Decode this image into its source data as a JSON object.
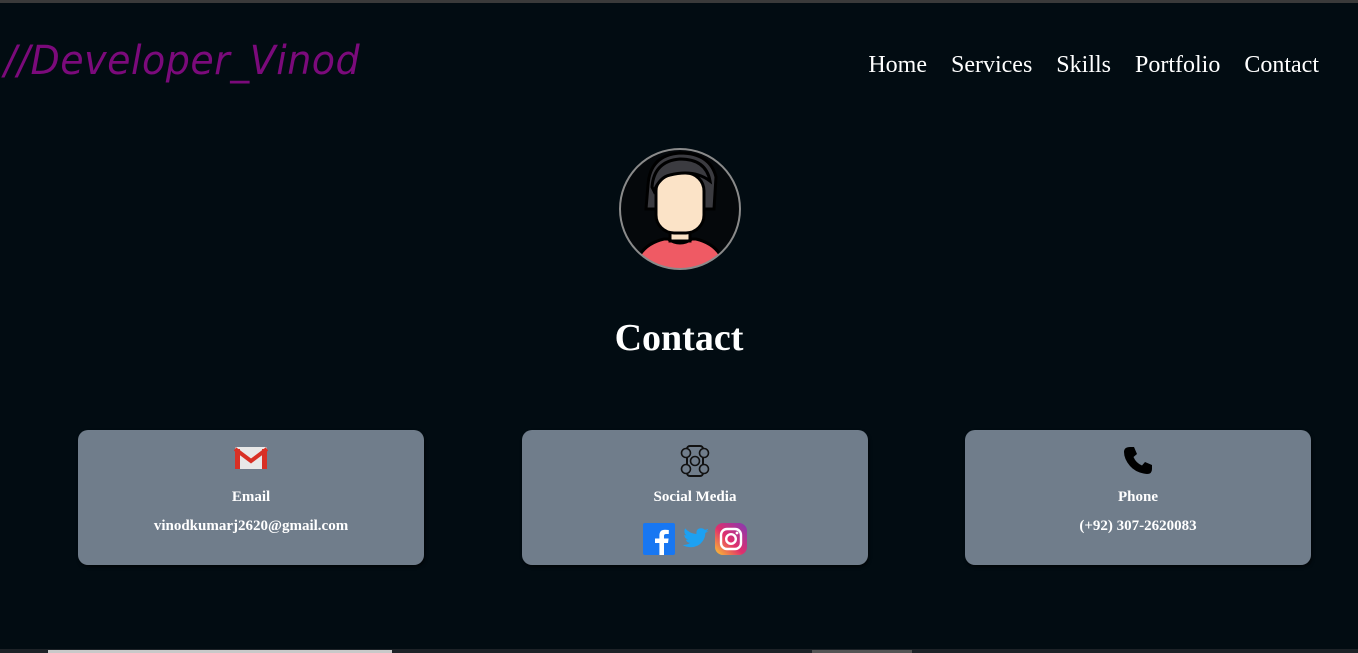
{
  "header": {
    "logo": "//Developer_Vinod",
    "nav": [
      "Home",
      "Services",
      "Skills",
      "Portfolio",
      "Contact"
    ]
  },
  "main": {
    "title": "Contact",
    "avatar_icon": "user-avatar-icon"
  },
  "cards": {
    "email": {
      "icon": "gmail-icon",
      "label": "Email",
      "value": "vinodkumarj2620@gmail.com"
    },
    "social": {
      "icon": "social-media-icon",
      "label": "Social Media",
      "links": [
        "facebook-icon",
        "twitter-icon",
        "instagram-icon"
      ]
    },
    "phone": {
      "icon": "phone-icon",
      "label": "Phone",
      "value": "(+92) 307-2620083"
    }
  },
  "colors": {
    "background": "#020c12",
    "logo": "#7b0a7b",
    "card": "#707d8b",
    "text": "#ffffff"
  }
}
